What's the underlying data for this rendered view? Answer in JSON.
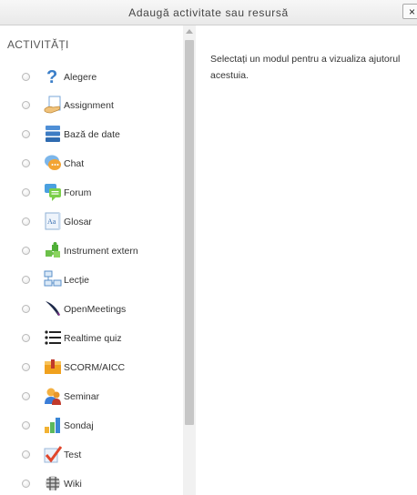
{
  "dialog": {
    "title": "Adaugă activitate sau resursă",
    "close_label": "×"
  },
  "sidebar": {
    "section_label": "ACTIVITĂȚI",
    "items": [
      {
        "label": "Alegere",
        "icon": "question-mark-icon"
      },
      {
        "label": "Assignment",
        "icon": "assignment-hand-icon"
      },
      {
        "label": "Bază de date",
        "icon": "database-icon"
      },
      {
        "label": "Chat",
        "icon": "chat-bubbles-icon"
      },
      {
        "label": "Forum",
        "icon": "forum-icon"
      },
      {
        "label": "Glosar",
        "icon": "glossary-book-icon"
      },
      {
        "label": "Instrument extern",
        "icon": "puzzle-icon"
      },
      {
        "label": "Lecție",
        "icon": "lesson-flow-icon"
      },
      {
        "label": "OpenMeetings",
        "icon": "feather-icon"
      },
      {
        "label": "Realtime quiz",
        "icon": "list-icon"
      },
      {
        "label": "SCORM/AICC",
        "icon": "package-icon"
      },
      {
        "label": "Seminar",
        "icon": "users-icon"
      },
      {
        "label": "Sondaj",
        "icon": "bar-chart-icon"
      },
      {
        "label": "Test",
        "icon": "checkmark-icon"
      },
      {
        "label": "Wiki",
        "icon": "wiki-icon"
      }
    ]
  },
  "help_panel": {
    "text": "Selectați un modul pentru a vizualiza ajutorul acestuia."
  }
}
